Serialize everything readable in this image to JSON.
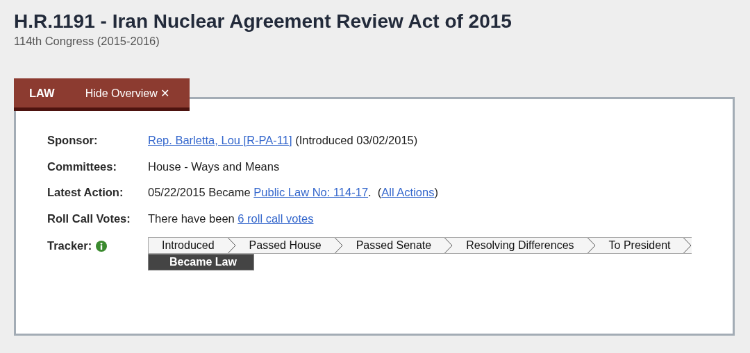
{
  "title": "H.R.1191 - Iran Nuclear Agreement Review Act of 2015",
  "subtitle": "114th Congress (2015-2016)",
  "tab": {
    "label": "LAW",
    "toggle": "Hide Overview ✕"
  },
  "rows": [
    {
      "label": "Sponsor:",
      "parts": [
        {
          "kind": "link",
          "text": "Rep. Barletta, Lou [R-PA-11]"
        },
        {
          "kind": "text",
          "text": " (Introduced 03/02/2015)"
        }
      ]
    },
    {
      "label": "Committees:",
      "parts": [
        {
          "kind": "text",
          "text": "House - Ways and Means"
        }
      ]
    },
    {
      "label": "Latest Action:",
      "parts": [
        {
          "kind": "text",
          "text": "05/22/2015 Became "
        },
        {
          "kind": "link",
          "text": "Public Law No: 114-17"
        },
        {
          "kind": "text",
          "text": ".  ("
        },
        {
          "kind": "link",
          "text": "All Actions"
        },
        {
          "kind": "text",
          "text": ")"
        }
      ]
    },
    {
      "label": "Roll Call Votes:",
      "parts": [
        {
          "kind": "text",
          "text": "There have been "
        },
        {
          "kind": "link",
          "text": "6 roll call votes"
        }
      ]
    }
  ],
  "tracker": {
    "label": "Tracker:",
    "steps": [
      {
        "label": "Introduced",
        "selected": false
      },
      {
        "label": "Passed House",
        "selected": false
      },
      {
        "label": "Passed Senate",
        "selected": false
      },
      {
        "label": "Resolving Differences",
        "selected": false
      },
      {
        "label": "To President",
        "selected": false
      },
      {
        "label": "Became Law",
        "selected": true
      }
    ]
  }
}
